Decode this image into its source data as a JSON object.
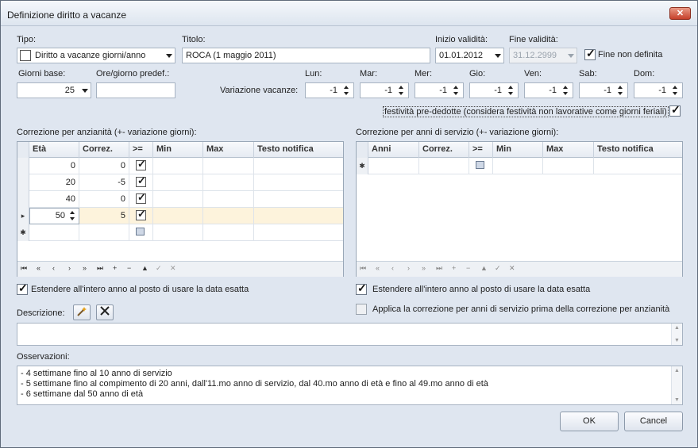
{
  "window": {
    "title": "Definizione diritto a vacanze",
    "close_label": "✕"
  },
  "tipo": {
    "label": "Tipo:",
    "value": "Diritto a vacanze giorni/anno"
  },
  "titolo": {
    "label": "Titolo:",
    "value": "ROCA (1 maggio 2011)"
  },
  "inizio": {
    "label": "Inizio validità:",
    "value": "01.01.2012"
  },
  "fine": {
    "label": "Fine validità:",
    "value": "31.12.2999",
    "nondef_label": "Fine non definita",
    "nondef_checked": true
  },
  "giorni_base": {
    "label": "Giorni base:",
    "value": "25"
  },
  "ore_giorno": {
    "label": "Ore/giorno predef.:",
    "value": ""
  },
  "variazione": {
    "label": "Variazione vacanze:",
    "days": [
      {
        "label": "Lun:",
        "value": "-1"
      },
      {
        "label": "Mar:",
        "value": "-1"
      },
      {
        "label": "Mer:",
        "value": "-1"
      },
      {
        "label": "Gio:",
        "value": "-1"
      },
      {
        "label": "Ven:",
        "value": "-1"
      },
      {
        "label": "Sab:",
        "value": "-1"
      },
      {
        "label": "Dom:",
        "value": "-1"
      }
    ]
  },
  "festivita": {
    "label": "festività pre-dedotte (considera festività non lavorative come giorni feriali)",
    "checked": true
  },
  "anzianita": {
    "label": "Correzione per anzianità (+- variazione giorni):",
    "columns": [
      "Età",
      "Correz.",
      ">=",
      "Min",
      "Max",
      "Testo notifica"
    ],
    "rows": [
      {
        "eta": "0",
        "correz": "0",
        "ge": true
      },
      {
        "eta": "20",
        "correz": "-5",
        "ge": true
      },
      {
        "eta": "40",
        "correz": "0",
        "ge": true
      },
      {
        "eta": "50",
        "correz": "5",
        "ge": true
      }
    ],
    "extend_label": "Estendere all'intero anno al posto di usare la data esatta",
    "extend_checked": true
  },
  "servizio": {
    "label": "Correzione per anni di servizio (+- variazione giorni):",
    "columns": [
      "Anni",
      "Correz.",
      ">=",
      "Min",
      "Max",
      "Testo notifica"
    ],
    "extend_label": "Estendere all'intero anno al posto di usare la data esatta",
    "extend_checked": true,
    "applica_label": "Applica la correzione per anni di servizio prima della correzione per anzianità",
    "applica_checked": false
  },
  "descrizione": {
    "label": "Descrizione:",
    "value": ""
  },
  "osservazioni": {
    "label": "Osservazioni:",
    "lines": [
      "- 4 settimane fino al 10 anno di servizio",
      "- 5 settimane fino al compimento di 20 anni, dall'11.mo anno di servizio, dal 40.mo anno di età e fino al 49.mo anno di età",
      "- 6 settimane dal 50 anno di età"
    ]
  },
  "buttons": {
    "ok": "OK",
    "cancel": "Cancel"
  },
  "nav_glyphs": [
    "⏮",
    "«",
    "‹",
    "›",
    "»",
    "⏭",
    "+",
    "−",
    "▲",
    "✓",
    "✕"
  ],
  "indicator": {
    "current": "▸",
    "new": "✱"
  }
}
